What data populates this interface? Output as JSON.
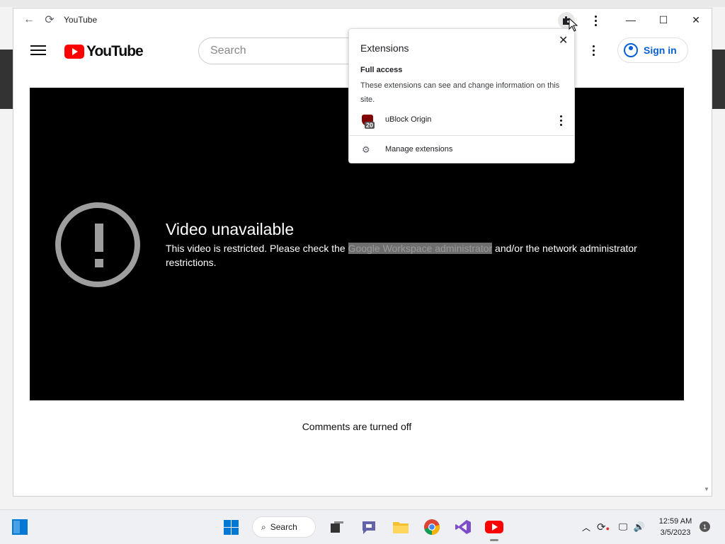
{
  "window": {
    "title": "YouTube",
    "minimize_glyph": "—",
    "maximize_glyph": "☐",
    "close_glyph": "✕"
  },
  "youtube": {
    "logo_text": "YouTube",
    "search_placeholder": "Search",
    "sign_in_label": "Sign in"
  },
  "player": {
    "error_title": "Video unavailable",
    "error_message_part1": "This video is restricted. Please check the ",
    "error_message_highlight": "Google Workspace administrator",
    "error_message_part2": " and/or the network administrator restrictions."
  },
  "comments": {
    "status": "Comments are turned off"
  },
  "extensions_popup": {
    "title": "Extensions",
    "section_title": "Full access",
    "section_description": "These extensions can see and change information on this site.",
    "items": [
      {
        "name": "uBlock Origin",
        "badge": "20"
      }
    ],
    "manage_label": "Manage extensions"
  },
  "taskbar": {
    "search_label": "Search",
    "time": "12:59 AM",
    "date": "3/5/2023",
    "notification_count": "1",
    "active_app": "youtube-app"
  },
  "colors": {
    "youtube_red": "#ff0000",
    "link_blue": "#065fd4",
    "player_bg": "#000000"
  }
}
